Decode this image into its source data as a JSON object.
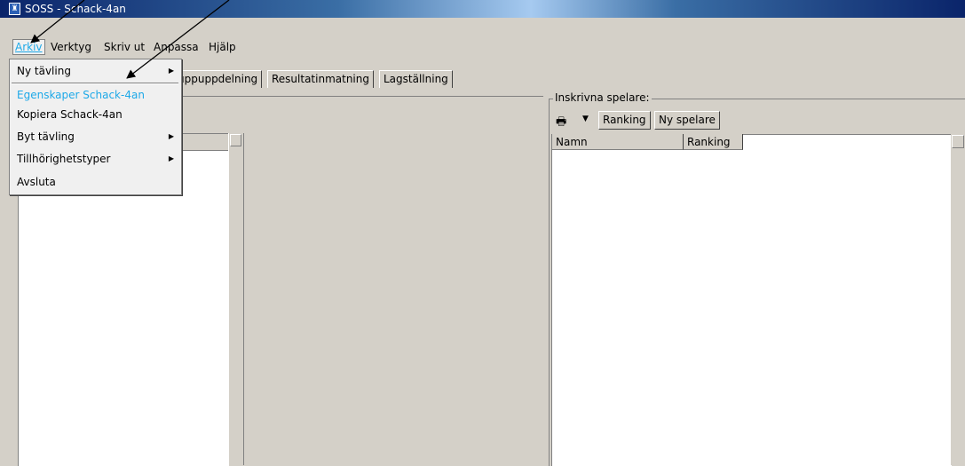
{
  "window": {
    "title": "SOSS - Schack-4an",
    "icon": "rook-icon"
  },
  "menubar": {
    "items": [
      {
        "label": "Arkiv",
        "accent": "A"
      },
      {
        "label": "Verktyg",
        "accent": "V"
      },
      {
        "label": "Skriv ut",
        "accent": "S"
      },
      {
        "label": "Anpassa",
        "accent": "n"
      },
      {
        "label": "Hjälp",
        "accent": "H"
      }
    ]
  },
  "file_menu": {
    "items": [
      {
        "label": "Ny tävling",
        "submenu": true
      },
      {
        "label": "Egenskaper Schack-4an",
        "submenu": false
      },
      {
        "label": "Kopiera Schack-4an",
        "submenu": false
      },
      {
        "label": "Byt tävling",
        "submenu": true
      },
      {
        "label": "Tillhörighetstyper",
        "submenu": true
      },
      {
        "label": "Avsluta",
        "submenu": false
      }
    ]
  },
  "tabs": [
    "uppuppdelning",
    "Resultatinmatning",
    "Lagställning"
  ],
  "players_group": {
    "label": "Inskrivna spelare:",
    "ranking_button": "Ranking",
    "new_player_button": "Ny spelare",
    "columns": [
      "Namn",
      "Ranking"
    ]
  },
  "colors": {
    "highlight": "#1ea9e8",
    "title_bar": "#0a246a"
  }
}
